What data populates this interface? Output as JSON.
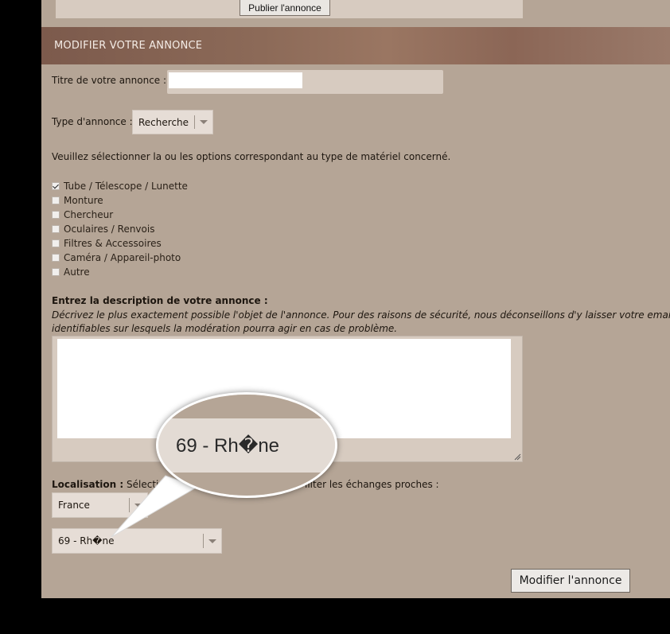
{
  "top": {
    "publish_label": "Publier l'annonce"
  },
  "header": {
    "title": "MODIFIER VOTRE ANNONCE"
  },
  "form": {
    "title_label": "Titre de votre annonce :",
    "title_value": "",
    "type_label": "Type d'annonce :",
    "type_value": "Recherche",
    "options_intro": "Veuillez sélectionner la ou les options correspondant au type de matériel concerné.",
    "options": [
      {
        "label": "Tube / Télescope / Lunette",
        "checked": true
      },
      {
        "label": "Monture",
        "checked": false
      },
      {
        "label": "Chercheur",
        "checked": false
      },
      {
        "label": "Oculaires / Renvois",
        "checked": false
      },
      {
        "label": "Filtres & Accessoires",
        "checked": false
      },
      {
        "label": "Caméra / Appareil-photo",
        "checked": false
      },
      {
        "label": "Autre",
        "checked": false
      }
    ],
    "description_label": "Entrez la description de votre annonce :",
    "description_help_1": "Décrivez le plus exactement possible l'objet de l'annonce. Pour des raisons de sécurité, nous déconseillons d'y laisser votre email ou",
    "description_help_2": "identifiables sur lesquels la modération pourra agir en cas de problème.",
    "description_value": "",
    "location_label": "Localisation :",
    "location_help_a": "Sélectionnez",
    "location_help_b": "iliter les échanges proches :",
    "country_value": "France",
    "region_value": "69 - Rh�ne",
    "submit_label": "Modifier l'annonce"
  },
  "zoom": {
    "text": "69 - Rh�ne"
  }
}
